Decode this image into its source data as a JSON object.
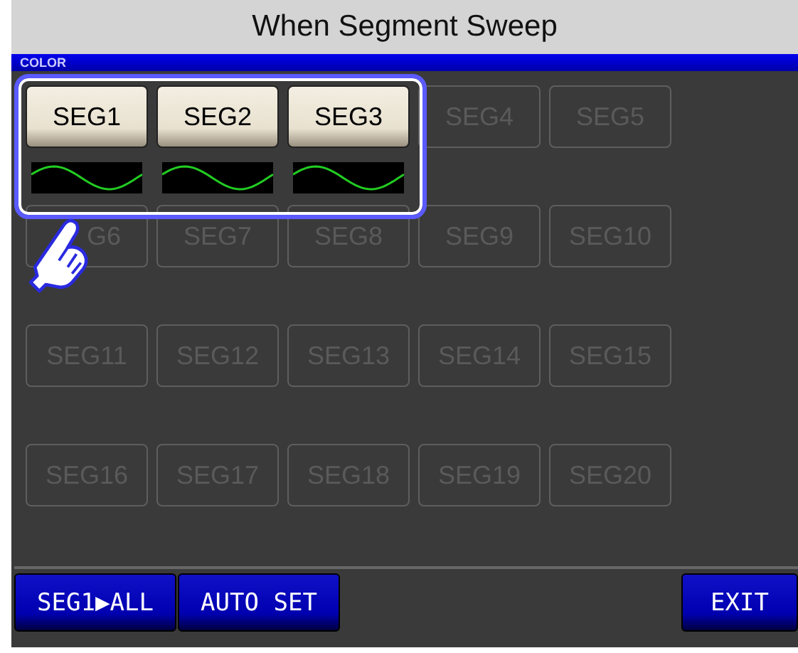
{
  "caption": "When Segment Sweep",
  "header": "COLOR",
  "segments": [
    {
      "label": "SEG1",
      "enabled": true
    },
    {
      "label": "SEG2",
      "enabled": true
    },
    {
      "label": "SEG3",
      "enabled": true
    },
    {
      "label": "SEG4",
      "enabled": false
    },
    {
      "label": "SEG5",
      "enabled": false
    },
    {
      "label": "G6",
      "enabled": false,
      "covered": true
    },
    {
      "label": "SEG7",
      "enabled": false
    },
    {
      "label": "SEG8",
      "enabled": false
    },
    {
      "label": "SEG9",
      "enabled": false
    },
    {
      "label": "SEG10",
      "enabled": false
    },
    {
      "label": "SEG11",
      "enabled": false
    },
    {
      "label": "SEG12",
      "enabled": false
    },
    {
      "label": "SEG13",
      "enabled": false
    },
    {
      "label": "SEG14",
      "enabled": false
    },
    {
      "label": "SEG15",
      "enabled": false
    },
    {
      "label": "SEG16",
      "enabled": false
    },
    {
      "label": "SEG17",
      "enabled": false
    },
    {
      "label": "SEG18",
      "enabled": false
    },
    {
      "label": "SEG19",
      "enabled": false
    },
    {
      "label": "SEG20",
      "enabled": false
    }
  ],
  "footer": {
    "left": [
      "SEG1▶ALL",
      "AUTO SET"
    ],
    "right": [
      "EXIT"
    ]
  }
}
